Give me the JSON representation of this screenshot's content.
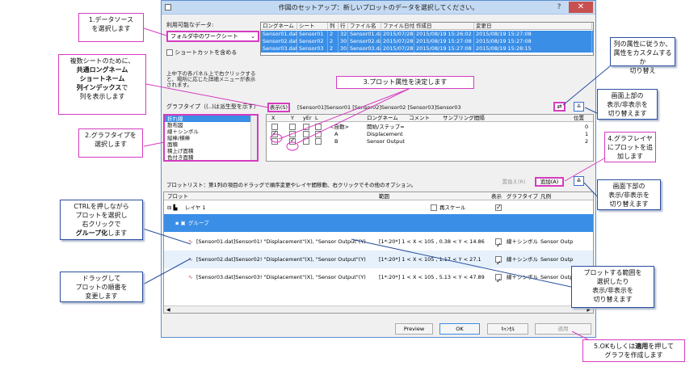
{
  "dialog": {
    "title": "作図のセットアップ：新しいプロットのデータを選択してください。",
    "help_label": "?",
    "close_label": "✕"
  },
  "source": {
    "label": "利用可能なデータ:",
    "selected": "フォルダ中のワークシート",
    "shortcut_label": "ショートカットを含める",
    "columns": [
      "ロングネーム",
      "シート",
      "列",
      "行",
      "ファイル名",
      "ファイル日付",
      "作成日",
      "変更日"
    ],
    "rows": [
      [
        "Sensor01.dat",
        "Sensor01",
        "2",
        "32",
        "Sensor01.dat",
        "2015/07/28",
        "2015/08/19 15:26:02",
        "2015/08/19 15:27:08"
      ],
      [
        "Sensor02.dat",
        "Sensor02",
        "2",
        "30",
        "Sensor02.dat",
        "2015/07/28",
        "2015/08/19 15:27:08",
        "2015/08/19 15:27:08"
      ],
      [
        "Sensor03.dat",
        "Sensor03",
        "2",
        "30",
        "Sensor03.dat",
        "2015/07/28",
        "2015/08/19 15:27:08",
        "2015/08/19 15:28:15"
      ]
    ],
    "info_text": "上中下の各パネル上で右クリックすると、場所に応じた詳細メニューが表示されます。"
  },
  "graph_type": {
    "label": "グラフタイプ（(..)は派生型を示す）",
    "items": [
      "折れ線",
      "散布図",
      "線＋シンボル",
      "縦棒/横棒",
      "面積",
      "積上げ面積",
      "色付き面積"
    ],
    "selected_index": 0
  },
  "attributes": {
    "show_label": "表示(S)",
    "series_text": "[Sensor01]Sensor01 [Sensor02]Sensor02 [Sensor03]Sensor03",
    "swap_icon": "⇄",
    "collapse_icon": "≚",
    "columns": [
      "X",
      "Y",
      "yEr",
      "L",
      "ロングネーム",
      "コメント",
      "サンプリング間隔",
      "位置"
    ],
    "rows": [
      {
        "label": "<自動>",
        "longname": "開始/ステップ=",
        "pos": "0",
        "x": false,
        "y": false
      },
      {
        "label": "A",
        "longname": "Displacement",
        "pos": "1",
        "x": true,
        "y": false
      },
      {
        "label": "B",
        "longname": "Sensor Output",
        "pos": "2",
        "x": false,
        "y": true
      }
    ]
  },
  "plot_list": {
    "label": "プロットリスト：第1列の項目のドラッグで順序変更やレイヤ間移動、右クリックでその他のオプション。",
    "replace_label": "置換え(R)",
    "add_label": "追加(A)",
    "expand_icon": "≙",
    "columns": [
      "プロット",
      "範囲",
      "表示",
      "グラフタイプ",
      "凡例"
    ],
    "layer": "レイヤ 1",
    "rescale_label": "再スケール",
    "group": "グループ",
    "rows": [
      {
        "plot": "[Sensor01.dat]Sensor01! \"Displacement\"(X), \"Sensor Output\"(Y)",
        "range": "[1*:20*]  1 < X < 105 , 0.38 < Y < 14.86",
        "type": "線＋シンボル",
        "legend": "Sensor Outp"
      },
      {
        "plot": "[Sensor02.dat]Sensor02! \"Displacement\"(X), \"Sensor Output\"(Y)",
        "range": "[1*:20*]  1 < X < 105 , 1.17 < Y < 27.1",
        "type": "線＋シンボル",
        "legend": "Sensor Outp"
      },
      {
        "plot": "[Sensor03.dat]Sensor03! \"Displacement\"(X), \"Sensor Output\"(Y)",
        "range": "[1*:20*]  1 < X < 105 , 5.13 < Y < 47.89",
        "type": "線＋シンボル",
        "legend": "Sensor Outp"
      }
    ]
  },
  "buttons": {
    "preview": "Preview",
    "ok": "OK",
    "cancel": "ｷｬﾝｾﾙ",
    "apply": "適用"
  },
  "callouts": {
    "c1": [
      "1.データソース",
      "を選択します"
    ],
    "c2": [
      "2.グラフタイプを",
      "選択します"
    ],
    "c3": [
      "3.プロット属性を決定します"
    ],
    "c_multi_line1": "複数シートのために、",
    "c_multi_bold": [
      "共通ロングネーム",
      "ショートネーム",
      "列インデックス"
    ],
    "c_multi_tail1": "で",
    "c_multi_tail2": "列を表示します",
    "c_ctrl": [
      "CTRLを押しながら",
      "プロットを選択し",
      "右クリックで"
    ],
    "c_ctrl_bold": "グループ化",
    "c_ctrl_tail": "します",
    "c_drag": [
      "ドラッグして",
      "プロットの順番を",
      "変更します"
    ],
    "c_attr": [
      "列の属性に従うか、",
      "属性をカスタムするか",
      "切り替え"
    ],
    "c_top": [
      "画面上部の",
      "表示/非表示を",
      "切り替えます"
    ],
    "c4": [
      "4.グラフレイヤ",
      "にプロットを追",
      "加します"
    ],
    "c_bottom": [
      "画面下部の",
      "表示/非表示を",
      "切り替えます"
    ],
    "c_range": [
      "プロットする範囲を",
      "選択したり",
      "表示/非表示を",
      "切り替えます"
    ],
    "c5_pre": "5.OKもしくは",
    "c5_bold": "適用",
    "c5_tail": "を押して",
    "c5_line2": "グラフを作成します"
  }
}
